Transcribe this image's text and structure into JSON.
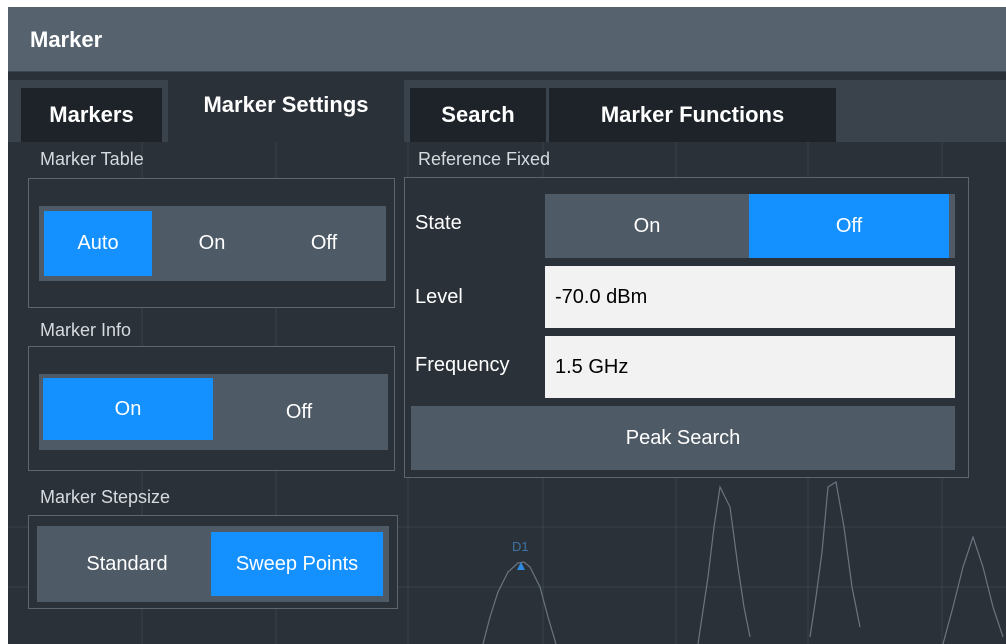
{
  "window": {
    "title": "Marker"
  },
  "tabs": [
    {
      "label": "Markers",
      "active": false
    },
    {
      "label": "Marker Settings",
      "active": true
    },
    {
      "label": "Search",
      "active": false
    },
    {
      "label": "Marker Functions",
      "active": false
    }
  ],
  "marker_table": {
    "label": "Marker Table",
    "options": [
      "Auto",
      "On",
      "Off"
    ],
    "selected": "Auto"
  },
  "marker_info": {
    "label": "Marker Info",
    "options": [
      "On",
      "Off"
    ],
    "selected": "On"
  },
  "marker_stepsize": {
    "label": "Marker Stepsize",
    "options": [
      "Standard",
      "Sweep Points"
    ],
    "selected": "Sweep Points"
  },
  "reference_fixed": {
    "label": "Reference Fixed",
    "state_label": "State",
    "state_options": [
      "On",
      "Off"
    ],
    "state_selected": "Off",
    "level_label": "Level",
    "level_value": "-70.0 dBm",
    "frequency_label": "Frequency",
    "frequency_value": "1.5 GHz",
    "peak_search_label": "Peak Search"
  },
  "background": {
    "marker_label": "D1"
  },
  "colors": {
    "accent": "#1591ff",
    "titlebar": "#56636f",
    "panel": "#2b3138",
    "segment": "#4e5a65"
  }
}
